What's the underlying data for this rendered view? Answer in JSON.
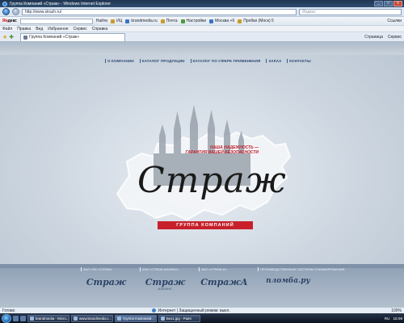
{
  "window": {
    "title": "Группа Компаний «Страж» - Windows Internet Explorer"
  },
  "address": {
    "url": "http://www.strazh.ru/",
    "search_placeholder": "Яндекс"
  },
  "toolbar": {
    "logo_red": "Ян",
    "logo_black": "декс",
    "search_btn": "Найти",
    "items": [
      "ИЦ",
      "brandmedia.ru",
      "Почта",
      "Настройки",
      "Москва +9",
      "Пробки (Моск) 5"
    ],
    "links": "Ссылки"
  },
  "menu": [
    "Файл",
    "Правка",
    "Вид",
    "Избранное",
    "Сервис",
    "Справка"
  ],
  "tab": {
    "label": "Группа Компаний «Страж»"
  },
  "tab_cmds": [
    "Страница",
    "Сервис"
  ],
  "sitenav": [
    "О КОМПАНИИ",
    "КАТАЛОГ ПРОДУКЦИИ",
    "КАТАЛОГ ПО СФЕРЕ ПРИМЕНЕНИЯ",
    "ЗАКАЗ",
    "КОНТАКТЫ"
  ],
  "hero": {
    "wordmark": "Страж",
    "slogan_line1": "НАША НАДЕЖНОСТЬ —",
    "slogan_line2": "ГАРАНТИЯ ВАШЕЙ БЕЗОПАСНОСТИ",
    "group_label": "ГРУППА КОМПАНИЙ"
  },
  "brands": [
    {
      "caption": "ЗАО «ПК «СТРАЖ»",
      "logo": "Страж",
      "sub": ""
    },
    {
      "caption": "ЗАО «СТРАЖ-АЛЬЯНС»",
      "logo": "Страж",
      "sub": "АЛЬЯНС"
    },
    {
      "caption": "ЗАО «СТРАЖ-А»",
      "logo": "СтражА",
      "sub": ""
    },
    {
      "caption": "ПРОИЗВОДСТВЕННЫЕ СИСТЕМЫ ПЛОМБИРОВАНИЯ",
      "logo": "пломба.ру",
      "sub": ""
    }
  ],
  "status": {
    "left": "Готово",
    "zone": "Интернет | Защищенный режим: выкл.",
    "zoom": "100%"
  },
  "taskbar": {
    "tasks": [
      "brandmedia - Micro...",
      "www.brandmedia.r...",
      "Группа Компаний...",
      "Без1.jpg - Paint"
    ],
    "lang": "RU",
    "clock": "15:09"
  }
}
